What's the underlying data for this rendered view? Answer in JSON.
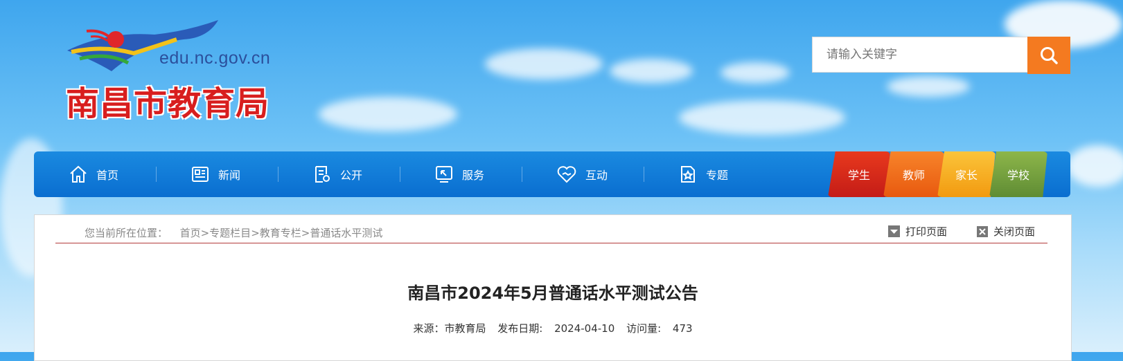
{
  "header": {
    "logo_url": "edu.nc.gov.cn",
    "logo_title": "南昌市教育局",
    "search": {
      "placeholder": "请输入关键字"
    }
  },
  "nav": {
    "items": [
      {
        "label": "首页",
        "icon": "home-icon"
      },
      {
        "label": "新闻",
        "icon": "newspaper-icon"
      },
      {
        "label": "公开",
        "icon": "document-icon"
      },
      {
        "label": "服务",
        "icon": "service-icon"
      },
      {
        "label": "互动",
        "icon": "heart-icon"
      },
      {
        "label": "专题",
        "icon": "topic-icon"
      }
    ],
    "tabs": [
      {
        "label": "学生",
        "color": "#d8261b"
      },
      {
        "label": "教师",
        "color": "#f26a13"
      },
      {
        "label": "家长",
        "color": "#f7a81c"
      },
      {
        "label": "学校",
        "color": "#6a9a3a"
      }
    ]
  },
  "page": {
    "breadcrumb": {
      "prefix": "您当前所在位置：",
      "items": [
        "首页",
        "专题栏目",
        "教育专栏",
        "普通话水平测试"
      ],
      "separator": ">"
    },
    "print_label": "打印页面",
    "close_label": "关闭页面",
    "title": "南昌市2024年5月普通话水平测试公告",
    "meta": {
      "source_label": "来源：",
      "source": "市教育局",
      "date_label": "发布日期:",
      "date": "2024-04-10",
      "views_label": "访问量:",
      "views": "473"
    }
  },
  "colors": {
    "nav_blue": "#0a6ed0",
    "search_button": "#f47a20",
    "logo_red": "#d81e1e",
    "rule_red": "#b33a3a"
  }
}
